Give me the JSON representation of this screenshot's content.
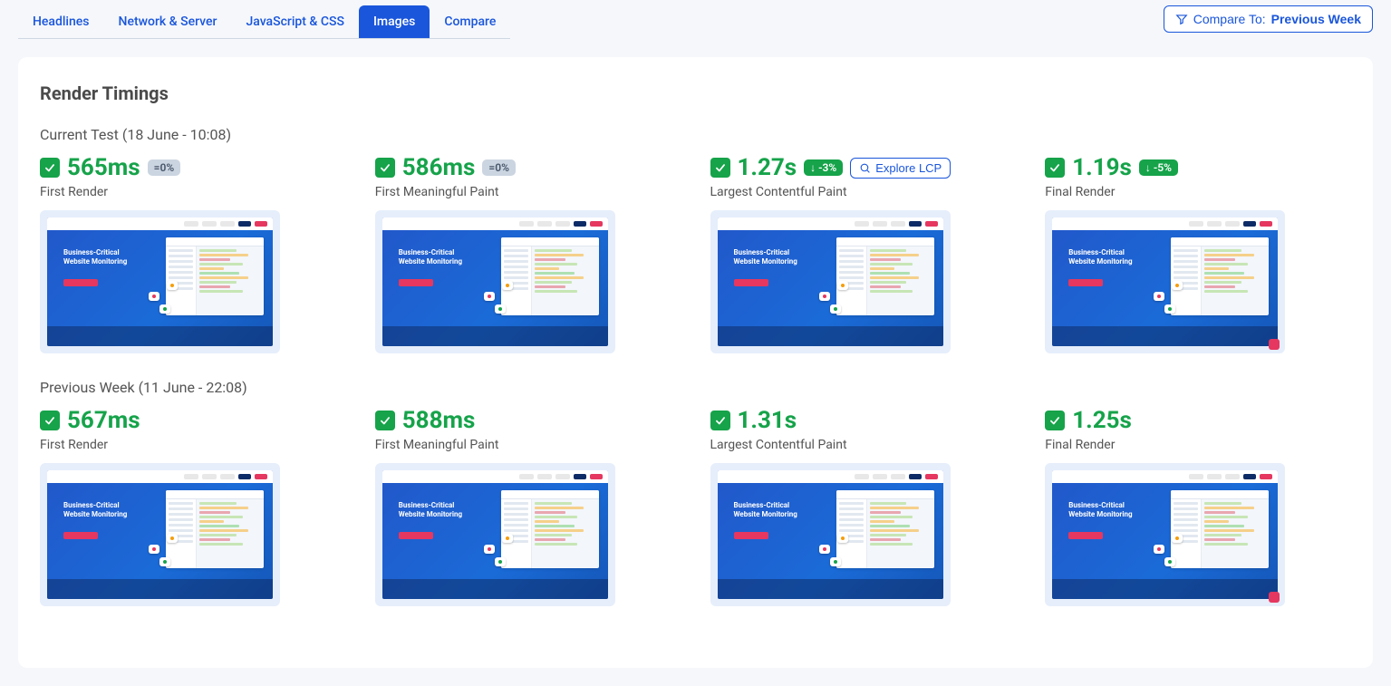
{
  "tabs": [
    {
      "id": "headlines",
      "label": "Headlines"
    },
    {
      "id": "network",
      "label": "Network & Server"
    },
    {
      "id": "jscss",
      "label": "JavaScript & CSS"
    },
    {
      "id": "images",
      "label": "Images"
    },
    {
      "id": "compare",
      "label": "Compare"
    }
  ],
  "active_tab": "images",
  "compare": {
    "label": "Compare To:",
    "value": "Previous Week"
  },
  "panel_title": "Render Timings",
  "groups": [
    {
      "label": "Current Test (18 June - 10:08)",
      "metrics": [
        {
          "value": "565ms",
          "delta": "=0%",
          "delta_style": "gray",
          "label": "First Render",
          "explore": false,
          "corner": false
        },
        {
          "value": "586ms",
          "delta": "=0%",
          "delta_style": "gray",
          "label": "First Meaningful Paint",
          "explore": false,
          "corner": false
        },
        {
          "value": "1.27s",
          "delta": "↓ -3%",
          "delta_style": "green",
          "label": "Largest Contentful Paint",
          "explore": true,
          "explore_label": "Explore LCP",
          "corner": false
        },
        {
          "value": "1.19s",
          "delta": "↓ -5%",
          "delta_style": "green",
          "label": "Final Render",
          "explore": false,
          "corner": true
        }
      ]
    },
    {
      "label": "Previous Week (11 June - 22:08)",
      "metrics": [
        {
          "value": "567ms",
          "delta": null,
          "label": "First Render",
          "corner": false
        },
        {
          "value": "588ms",
          "delta": null,
          "label": "First Meaningful Paint",
          "corner": false
        },
        {
          "value": "1.31s",
          "delta": null,
          "label": "Largest Contentful Paint",
          "corner": false
        },
        {
          "value": "1.25s",
          "delta": null,
          "label": "Final Render",
          "corner": true
        }
      ]
    }
  ],
  "thumb_hero_line1": "Business-Critical",
  "thumb_hero_line2": "Website Monitoring"
}
